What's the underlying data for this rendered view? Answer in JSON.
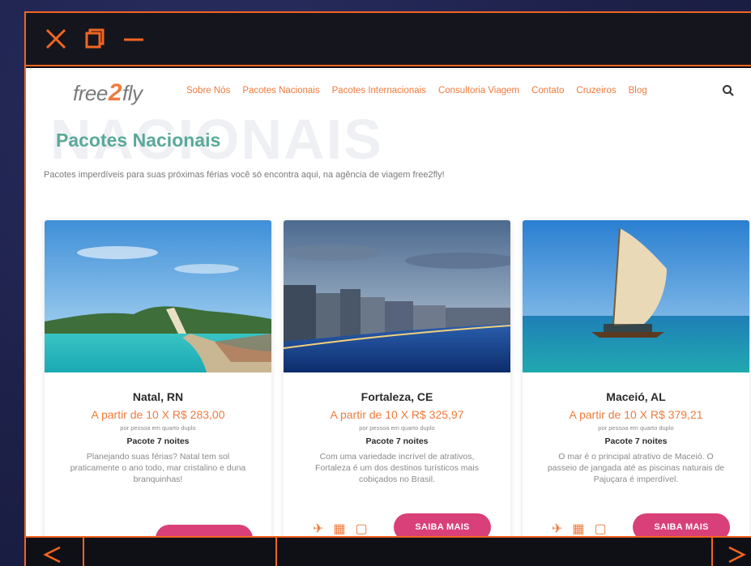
{
  "site": {
    "logo_text_left": "free",
    "logo_text_mid": "2",
    "logo_text_right": "fly",
    "nav": [
      "Sobre Nós",
      "Pacotes Nacionais",
      "Pacotes Internacionais",
      "Consultoria Viagem",
      "Contato",
      "Cruzeiros",
      "Blog"
    ]
  },
  "page": {
    "bg_word": "NACIONAIS",
    "title": "Pacotes Nacionais",
    "description": "Pacotes imperdíveis para suas próximas férias você só encontra aqui, na agência de viagem free2fly!"
  },
  "cards": [
    {
      "city": "Natal, RN",
      "price": "A partir de 10 X R$ 283,00",
      "note": "por pessoa em quarto duplo",
      "nights": "Pacote 7 noites",
      "text": "Planejando suas férias? Natal tem sol praticamente o ano todo, mar cristalino e duna branquinhas!",
      "button": ""
    },
    {
      "city": "Fortaleza, CE",
      "price": "A partir de 10 X R$ 325,97",
      "note": "por pessoa em quarto duplo",
      "nights": "Pacote 7 noites",
      "text": "Com uma variedade incrível de atrativos, Fortaleza é um dos destinos turísticos mais cobiçados no Brasil.",
      "button": "SAIBA MAIS"
    },
    {
      "city": "Maceió, AL",
      "price": "A partir de 10 X R$ 379,21",
      "note": "por pessoa em quarto duplo",
      "nights": "Pacote 7 noites",
      "text": "O mar é o principal atrativo de Maceió. O passeio de jangada até as piscinas naturais de Pajuçara é imperdível.",
      "button": "SAIBA MAIS"
    }
  ],
  "icons": {
    "window": [
      "close-icon",
      "restore-icon",
      "minimize-icon"
    ],
    "nav": [
      "search-icon",
      "chevron-left-icon",
      "chevron-right-icon"
    ],
    "card": [
      "plane-icon",
      "hotel-icon",
      "transfer-icon"
    ]
  },
  "colors": {
    "frame_accent": "#f26522",
    "brand_orange": "#f07a3c",
    "title_teal": "#5aa99a",
    "button_pink": "#d93f78",
    "desktop_bg": "#1d2048"
  }
}
